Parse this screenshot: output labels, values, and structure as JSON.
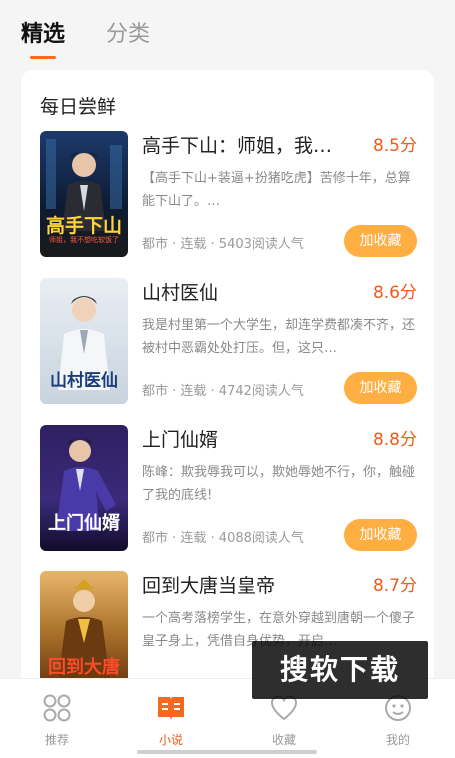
{
  "top_tabs": [
    {
      "label": "精选",
      "active": true
    },
    {
      "label": "分类",
      "active": false
    }
  ],
  "section": {
    "title": "每日尝鲜"
  },
  "books": [
    {
      "title": "高手下山：师姐，我…",
      "score": "8.5分",
      "description": "【高手下山+装逼+扮猪吃虎】苦修十年，总算能下山了。…",
      "meta": "都市 · 连载 · 5403阅读人气",
      "button": "加收藏",
      "cover_title": "高手下山",
      "cover_subtitle": "师姐，我不想吃软饭了"
    },
    {
      "title": "山村医仙",
      "score": "8.6分",
      "description": "我是村里第一个大学生，却连学费都凑不齐，还被村中恶霸处处打压。但，这只…",
      "meta": "都市 · 连载 · 4742阅读人气",
      "button": "加收藏",
      "cover_title": "山村医仙"
    },
    {
      "title": "上门仙婿",
      "score": "8.8分",
      "description": "陈峰：欺我辱我可以，欺她辱她不行，你，触碰了我的底线!",
      "meta": "都市 · 连载 · 4088阅读人气",
      "button": "加收藏",
      "cover_title": "上门仙婿"
    },
    {
      "title": "回到大唐当皇帝",
      "score": "8.7分",
      "description": "一个高考落榜学生，在意外穿越到唐朝一个傻子皇子身上，凭借自身优势，开启…",
      "meta": "",
      "button": "",
      "cover_title": "回到大唐"
    }
  ],
  "bottom_nav": [
    {
      "label": "推荐",
      "icon": "grid-icon",
      "active": false
    },
    {
      "label": "小说",
      "icon": "book-icon",
      "active": true
    },
    {
      "label": "收藏",
      "icon": "heart-icon",
      "active": false
    },
    {
      "label": "我的",
      "icon": "profile-icon",
      "active": false
    }
  ],
  "watermark": "搜软下载",
  "colors": {
    "accent": "#f05a1a",
    "button": "#ffae42"
  }
}
